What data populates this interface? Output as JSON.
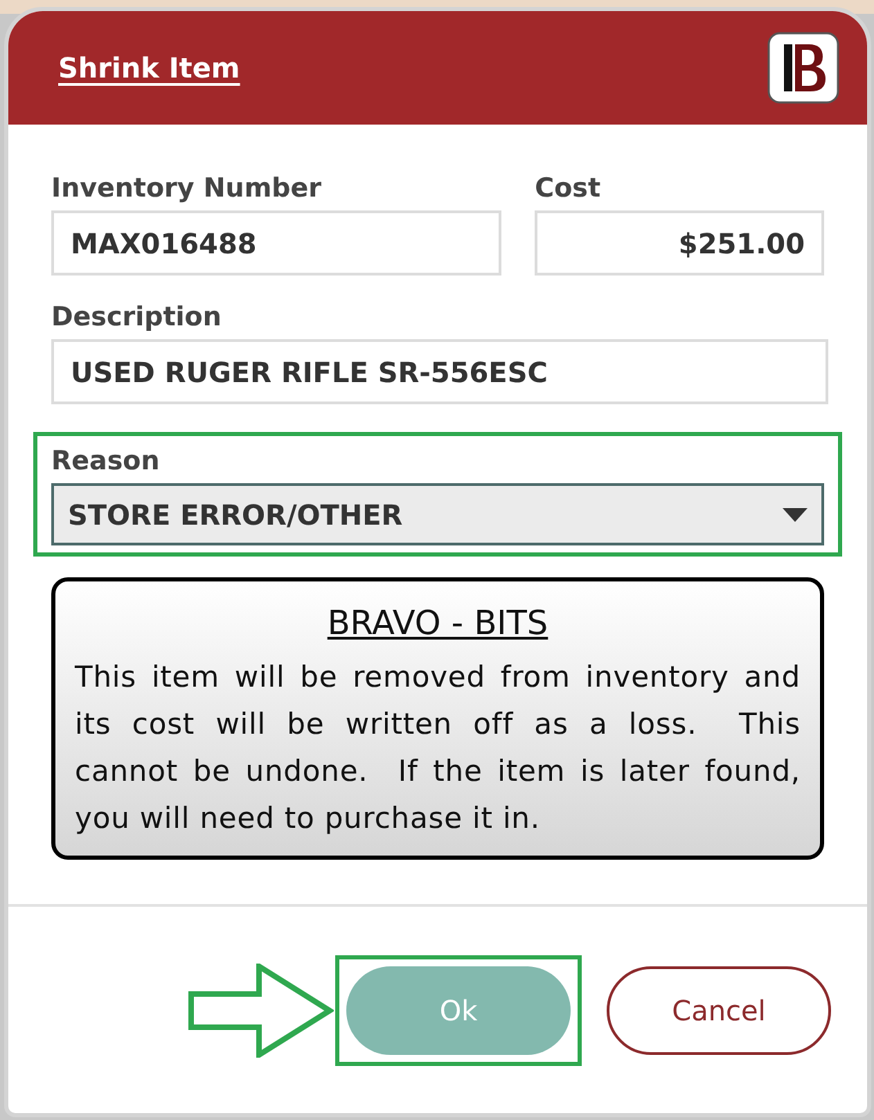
{
  "dialog": {
    "title": "Shrink Item"
  },
  "fields": [
    {
      "label": "Inventory Number",
      "value": "MAX016488",
      "kind": "text"
    },
    {
      "label": "Cost",
      "value": "$251.00",
      "kind": "currency"
    },
    {
      "label": "Description",
      "value": "USED RUGER RIFLE SR-556ESC",
      "kind": "text"
    }
  ],
  "reason": {
    "label": "Reason",
    "value": "STORE ERROR/OTHER",
    "highlighted": true
  },
  "notice": {
    "title": "BRAVO - BITS",
    "text": "This item will be removed from inventory and its cost will be written off as a loss.  This cannot be undone.  If the item is later found, you will need to purchase it in."
  },
  "buttons": [
    {
      "label": "Ok",
      "kind": "primary",
      "highlighted": true
    },
    {
      "label": "Cancel",
      "kind": "secondary",
      "highlighted": false
    }
  ]
}
